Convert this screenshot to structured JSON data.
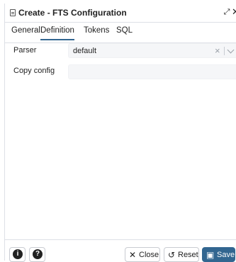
{
  "dialog": {
    "title": "Create - FTS Configuration",
    "title_icon": "document-icon",
    "expand_icon": "expand-icon",
    "close_icon": "close-icon"
  },
  "tabs": [
    {
      "label": "General",
      "active": false
    },
    {
      "label": "Definition",
      "active": true
    },
    {
      "label": "Tokens",
      "active": false
    },
    {
      "label": "SQL",
      "active": false
    }
  ],
  "form": {
    "parser": {
      "label": "Parser",
      "value": "default"
    },
    "copy_config": {
      "label": "Copy config",
      "value": ""
    }
  },
  "footer": {
    "info_icon_glyph": "i",
    "help_icon_glyph": "?",
    "close_label": "Close",
    "reset_label": "Reset",
    "save_label": "Save"
  },
  "colors": {
    "accent": "#326690",
    "border": "#dde0e6",
    "field_bg": "#f5f6f8"
  }
}
